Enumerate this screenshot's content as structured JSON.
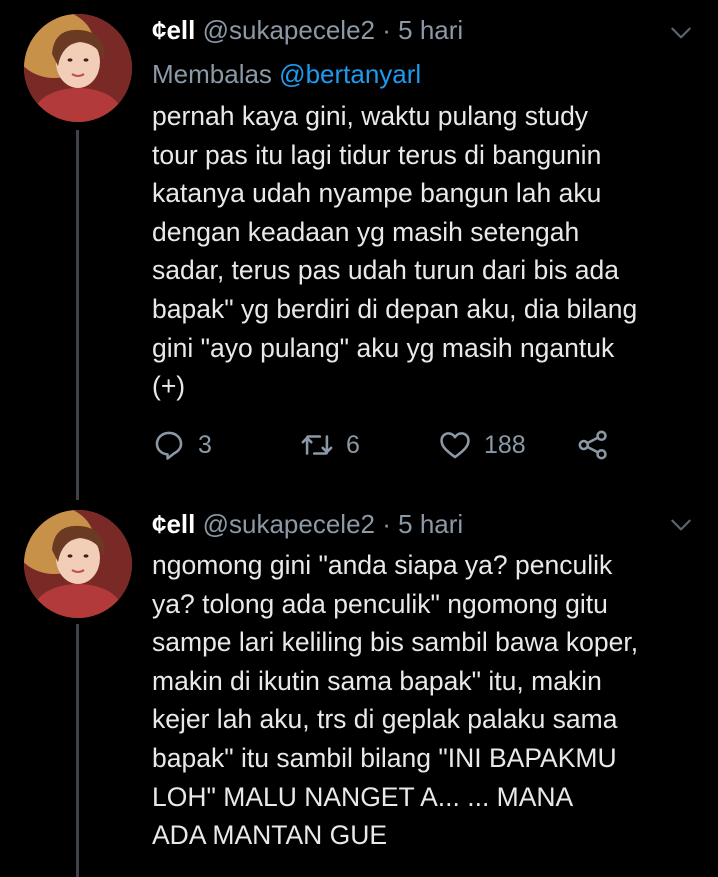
{
  "tweets": [
    {
      "author_name": "¢ell",
      "author_handle": "@sukapecele2",
      "separator": "·",
      "time": "5 hari",
      "reply_prefix": "Membalas",
      "reply_to": "@bertanyarl",
      "text": "pernah kaya gini, waktu pulang study\ntour pas itu lagi tidur terus di bangunin\nkatanya udah nyampe bangun lah aku\ndengan keadaan yg masih setengah\nsadar, terus pas udah turun dari bis ada\nbapak\" yg berdiri di depan aku, dia bilang\ngini \"ayo pulang\" aku yg masih ngantuk\n(+)",
      "reply_count": "3",
      "retweet_count": "6",
      "like_count": "188"
    },
    {
      "author_name": "¢ell",
      "author_handle": "@sukapecele2",
      "separator": "·",
      "time": "5 hari",
      "text": "ngomong gini \"anda siapa ya? penculik\nya? tolong ada penculik\" ngomong gitu\nsampe lari keliling bis sambil bawa koper,\nmakin di ikutin sama bapak\" itu, makin\nkejer lah aku, trs di geplak palaku sama\nbapak\" itu sambil bilang \"INI BAPAKMU\nLOH\" MALU NANGET A... ... MANA\nADA MANTAN GUE"
    }
  ],
  "icons": {
    "reply": "reply-icon",
    "retweet": "retweet-icon",
    "like": "heart-icon",
    "share": "share-icon",
    "menu": "chevron-down-icon"
  },
  "colors": {
    "background": "#000000",
    "text": "#e7e9ea",
    "secondary": "#8b98a5",
    "link": "#1d9bf0"
  }
}
